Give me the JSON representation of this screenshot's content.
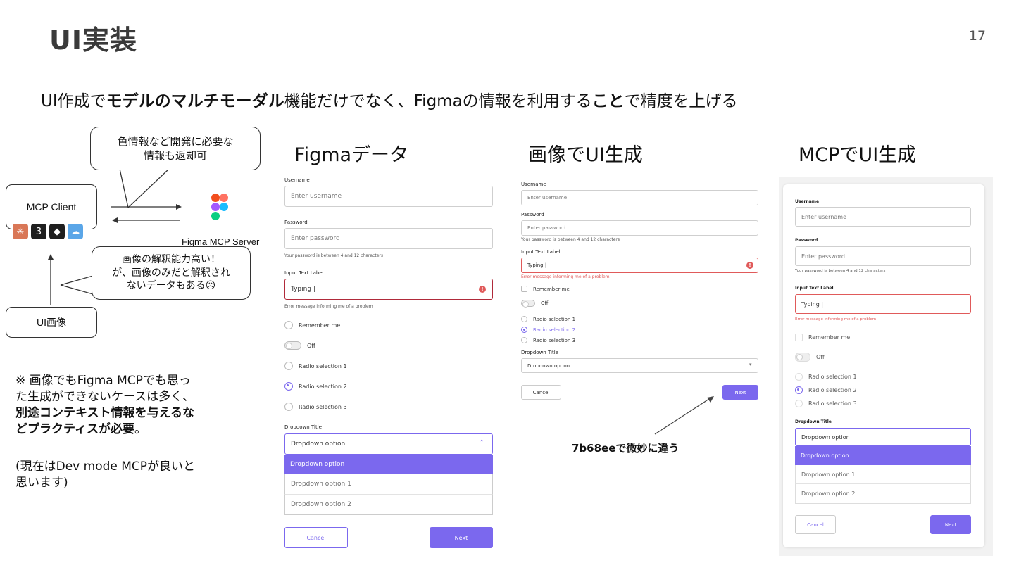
{
  "header": {
    "title": "UI実装",
    "page_number": "17"
  },
  "subtitle": {
    "part1": "UI作成で",
    "part2": "モデルのマルチモーダル",
    "part3": "機能だけでなく、Figmaの情報を利用する",
    "part4": "こと",
    "part5": "で精度を",
    "part6": "上",
    "part7": "げる"
  },
  "diagram": {
    "bubble_top": "色情報など開発に必要な\n情報も返却可",
    "mcp_client": "MCP Client",
    "figma_server": "Figma MCP Server",
    "bubble_mid": "画像の解釈能力高い！\nが、画像のみだと解釈され\nないデータもある😥",
    "ui_image": "UI画像",
    "tools": [
      {
        "icon": "claude-icon",
        "glyph": "✳",
        "color": "#d97757"
      },
      {
        "icon": "cursor-icon",
        "glyph": "3",
        "color": "#1f1f1f"
      },
      {
        "icon": "cube-icon",
        "glyph": "◆",
        "color": "#1f1f1f"
      },
      {
        "icon": "robot-icon",
        "glyph": "☁",
        "color": "#5aa6e8"
      }
    ]
  },
  "note": {
    "line1": "※ 画像でもFigma MCPでも思っ\nた生成ができないケースは多く、",
    "bold": "別途コンテキスト情報を与えるな\nどプラクティスが必要",
    "end": "。",
    "line2": "(現在はDev mode MCPが良いと\n思います)"
  },
  "sections": {
    "figma": "Figmaデータ",
    "image": "画像でUI生成",
    "mcp": "MCPでUI生成"
  },
  "form": {
    "username_label": "Username",
    "username_placeholder": "Enter username",
    "password_label": "Password",
    "password_placeholder": "Enter password",
    "password_hint": "Your password is between 4 and 12 characters",
    "input_label": "Input Text Label",
    "input_value": "Typing |",
    "error_message": "Error message informing me of a problem",
    "remember": "Remember me",
    "toggle": "Off",
    "radios": [
      "Radio selection 1",
      "Radio selection 2",
      "Radio selection 3"
    ],
    "dropdown_title": "Dropdown Title",
    "dropdown_value": "Dropdown option",
    "dropdown_options": [
      "Dropdown option",
      "Dropdown option 1",
      "Dropdown option 2"
    ],
    "cancel": "Cancel",
    "next": "Next",
    "error_icon": "!"
  },
  "caption": "7b68eeで微妙に違う",
  "colors": {
    "accent": "#7b68ee",
    "error": "#e05a5a"
  }
}
